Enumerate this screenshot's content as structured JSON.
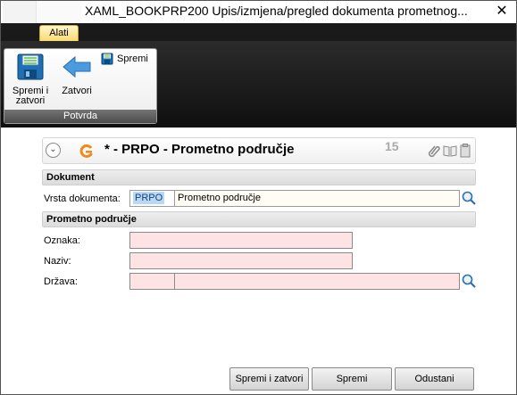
{
  "window": {
    "title": "XAML_BOOKPRP200  Upis/izmjena/pregled dokumenta prometnog...",
    "close_label": "✕"
  },
  "ribbon": {
    "tab_label": "Alati",
    "group_label": "Potvrda",
    "buttons": {
      "save_close_line1": "Spremi i",
      "save_close_line2": "zatvori",
      "close_label": "Zatvori",
      "save_label": "Spremi"
    }
  },
  "document": {
    "header_title": "*  -  PRPO  -  Prometno područje",
    "record_count": "15",
    "section_document": "Dokument",
    "doc_type_label": "Vrsta dokumenta:",
    "doc_type_code": "PRPO",
    "doc_type_name": "Prometno područje",
    "section_area": "Prometno područje",
    "oznaka_label": "Oznaka:",
    "oznaka_value": "",
    "naziv_label": "Naziv:",
    "naziv_value": "",
    "drzava_label": "Država:",
    "drzava_code": "",
    "drzava_name": ""
  },
  "footer": {
    "save_close_label": "Spremi i zatvori",
    "save_label": "Spremi",
    "cancel_label": "Odustani"
  },
  "colors": {
    "ribbon_dark": "#1a1a1a",
    "tab_active": "#f7d86a",
    "required_field": "#fde3e3",
    "code_highlight": "#b8d8f4",
    "brand_orange": "#f08a1c"
  }
}
